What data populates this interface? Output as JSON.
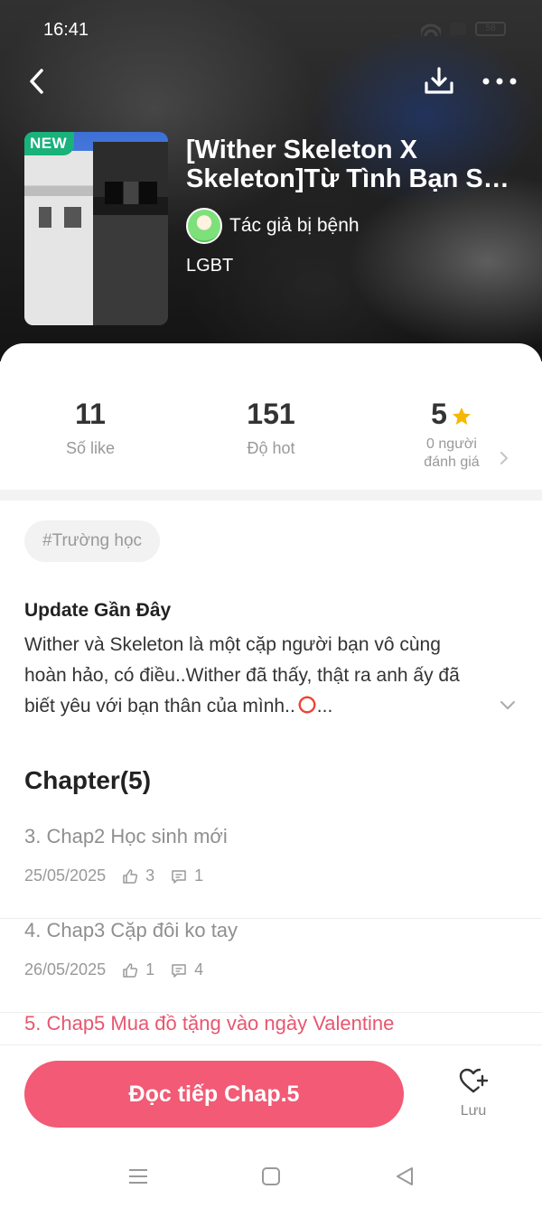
{
  "status_bar": {
    "time": "16:41",
    "battery": "58"
  },
  "story": {
    "badge": "NEW",
    "title_line1": "[Wither Skeleton X",
    "title_line2": "Skeleton]Từ Tình Bạn San...",
    "author": "Tác giả bị bệnh",
    "genre": "LGBT"
  },
  "stats": {
    "likes_value": "11",
    "likes_label": "Số like",
    "hot_value": "151",
    "hot_label": "Độ hot",
    "rating_value": "5",
    "rating_label_line1": "0 người",
    "rating_label_line2": "đánh giá"
  },
  "tag": "#Trường học",
  "update": {
    "heading": "Update Gần Đây",
    "line1": "Wither và Skeleton là một cặp người bạn vô cùng",
    "line2": "hoàn hảo, có điều..Wither đã thấy, thật ra anh ấy đã",
    "line3": "biết yêu với bạn thân của mình..",
    "line3_suffix": "..."
  },
  "chapters": {
    "heading": "Chapter(5)",
    "items": [
      {
        "title": "3. Chap2 Học sinh mới",
        "date": "25/05/2025",
        "likes": "3",
        "comments": "1"
      },
      {
        "title": "4. Chap3 Cặp đôi ko tay",
        "date": "26/05/2025",
        "likes": "1",
        "comments": "4"
      },
      {
        "title": "5. Chap5 Mua đồ tặng vào ngày Valentine"
      }
    ]
  },
  "bottom": {
    "read_label": "Đọc tiếp Chap.5",
    "save_label": "Lưu"
  },
  "colors": {
    "accent": "#f25a75",
    "badge": "#18b27a",
    "star": "#f5b800"
  }
}
